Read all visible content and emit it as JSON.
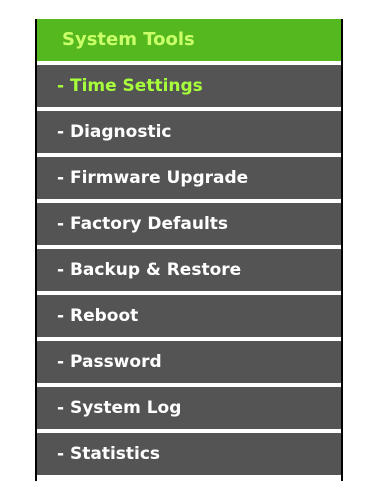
{
  "menu": {
    "header_label": "System Tools",
    "active_item": "- Time Settings",
    "colors": {
      "header_bg": "#55b81f",
      "header_text": "#c9ff68",
      "item_bg": "#545454",
      "item_text": "#ffffff",
      "active_text": "#a7ff3c"
    },
    "items": [
      {
        "label": "- Time Settings"
      },
      {
        "label": "- Diagnostic"
      },
      {
        "label": "- Firmware Upgrade"
      },
      {
        "label": "- Factory Defaults"
      },
      {
        "label": "- Backup & Restore"
      },
      {
        "label": "- Reboot"
      },
      {
        "label": "- Password"
      },
      {
        "label": "- System Log"
      },
      {
        "label": "- Statistics"
      }
    ]
  }
}
